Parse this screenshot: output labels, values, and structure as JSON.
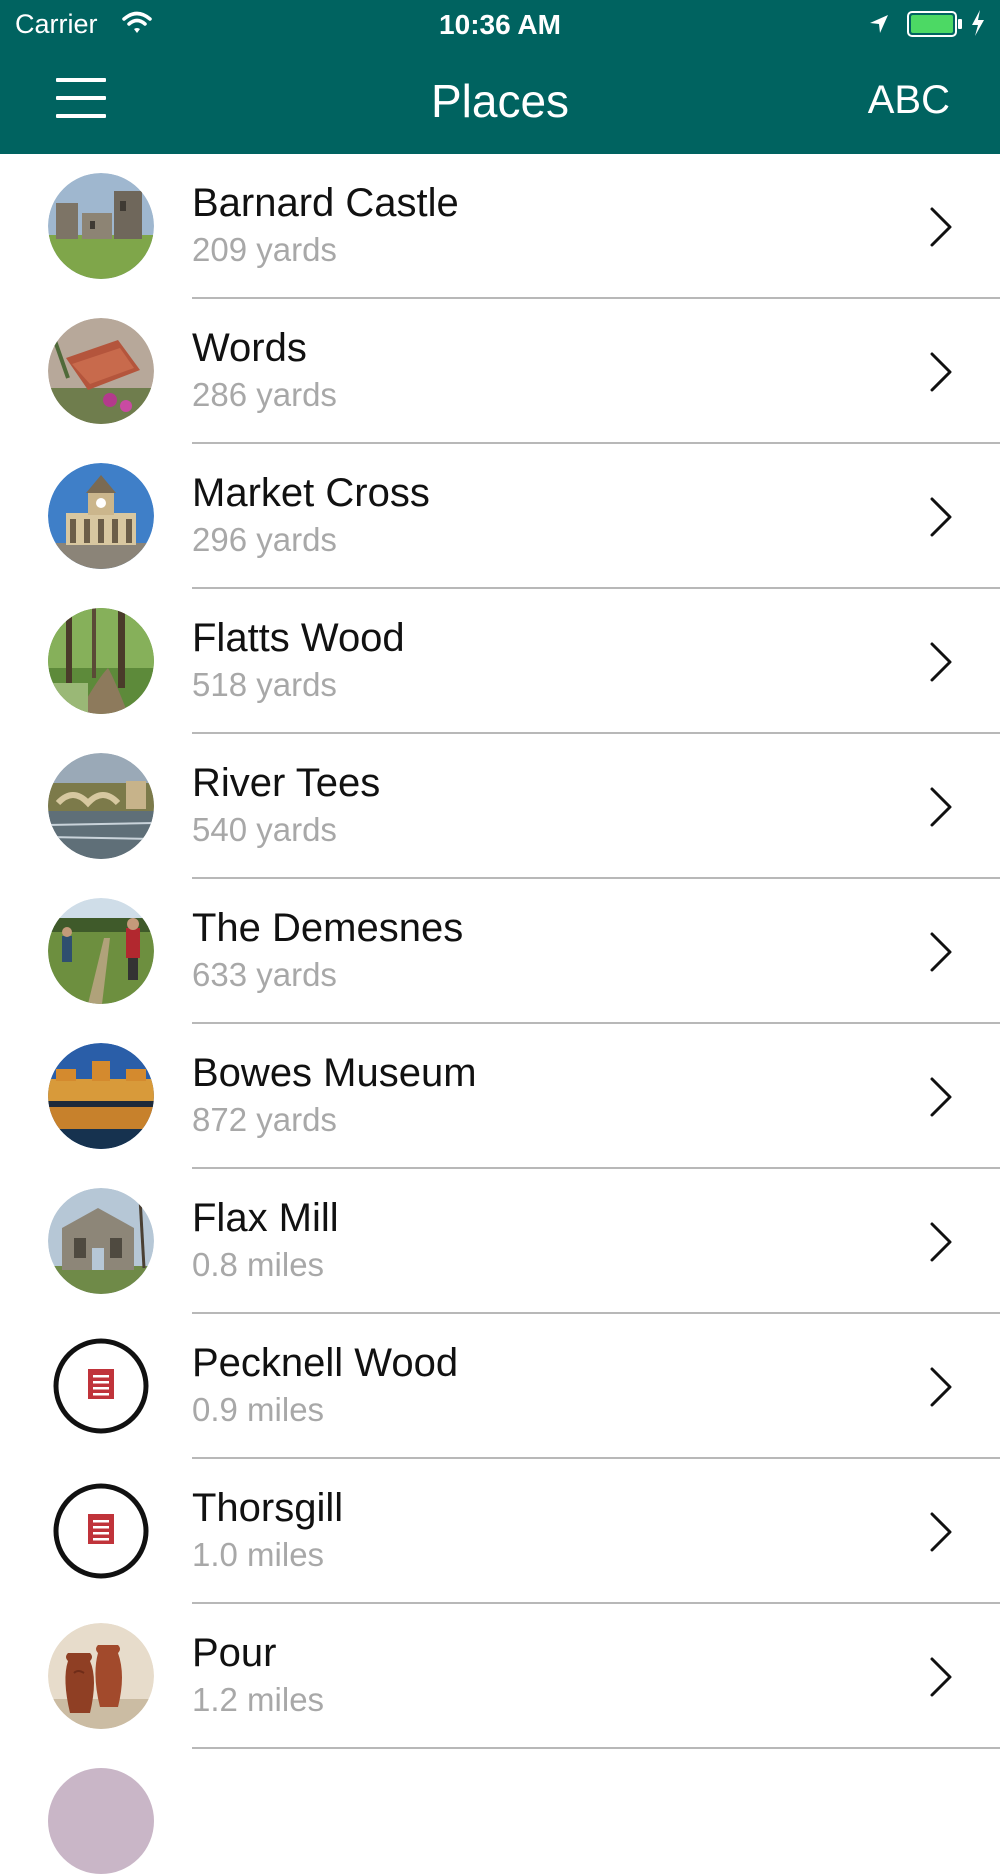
{
  "status_bar": {
    "carrier": "Carrier",
    "time": "10:36 AM"
  },
  "nav": {
    "title": "Places",
    "sort_label": "ABC",
    "menu_icon": "hamburger-menu-icon"
  },
  "theme": {
    "header_color": "#006360",
    "battery_color": "#4cd964"
  },
  "places": [
    {
      "name": "Barnard Castle",
      "distance": "209 yards",
      "thumb": "castle-photo"
    },
    {
      "name": "Words",
      "distance": "286 yards",
      "thumb": "words-photo"
    },
    {
      "name": "Market Cross",
      "distance": "296 yards",
      "thumb": "market-cross-photo"
    },
    {
      "name": "Flatts Wood",
      "distance": "518 yards",
      "thumb": "woodland-photo"
    },
    {
      "name": "River Tees",
      "distance": "540 yards",
      "thumb": "river-photo"
    },
    {
      "name": "The Demesnes",
      "distance": "633 yards",
      "thumb": "meadow-photo"
    },
    {
      "name": "Bowes Museum",
      "distance": "872 yards",
      "thumb": "museum-photo"
    },
    {
      "name": "Flax Mill",
      "distance": "0.8 miles",
      "thumb": "ruin-photo"
    },
    {
      "name": "Pecknell Wood",
      "distance": "0.9 miles",
      "thumb": "circle-seal-icon"
    },
    {
      "name": "Thorsgill",
      "distance": "1.0 miles",
      "thumb": "circle-seal-icon"
    },
    {
      "name": "Pour",
      "distance": "1.2 miles",
      "thumb": "pottery-photo"
    }
  ]
}
